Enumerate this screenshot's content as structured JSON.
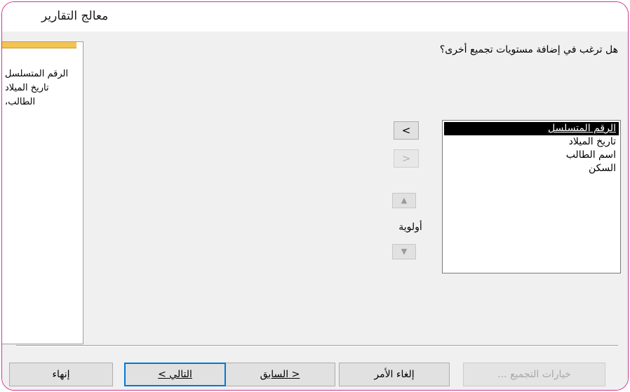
{
  "window": {
    "title": "معالج التقارير"
  },
  "question": "هل ترغب في إضافة مستويات تجميع أخرى؟",
  "preview": {
    "lines": [
      "الرقم المتسلسل",
      "تاريخ الميلاد",
      "الطالب،"
    ]
  },
  "fields": [
    {
      "label": "الرقم المتسلسل",
      "selected": true
    },
    {
      "label": "تاريخ الميلاد",
      "selected": false
    },
    {
      "label": "اسم الطالب",
      "selected": false
    },
    {
      "label": "السكن",
      "selected": false
    }
  ],
  "controls": {
    "add_label": ">",
    "remove_label": "<",
    "priority_label": "أولوية",
    "up_icon": "up-arrow-icon",
    "down_icon": "down-arrow-icon"
  },
  "buttons": {
    "grouping_options": "خيارات التجميع ...",
    "cancel": "إلغاء الأمر",
    "back": "< السابق",
    "next": "التالي >",
    "finish": "إنهاء"
  },
  "colors": {
    "accent": "#0078d7",
    "frame": "#d6338f",
    "preview_header": "#f3c44f"
  }
}
